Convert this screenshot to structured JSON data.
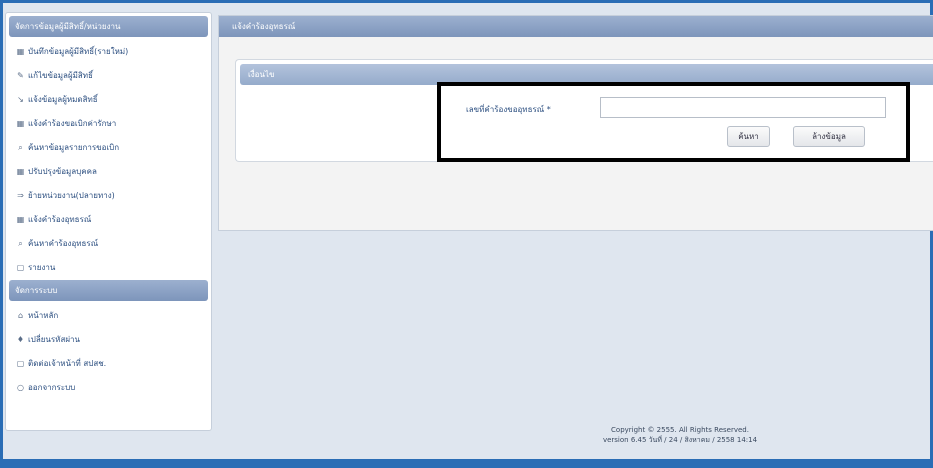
{
  "sidebar": {
    "section1_title": "จัดการข้อมูลผู้มีสิทธิ์/หน่วยงาน",
    "items1": [
      {
        "icon": "▦",
        "icon_name": "grid-icon",
        "label": "บันทึกข้อมูลผู้มีสิทธิ์(รายใหม่)"
      },
      {
        "icon": "✎",
        "icon_name": "pencil-icon",
        "label": "แก้ไขข้อมูลผู้มีสิทธิ์"
      },
      {
        "icon": "↘",
        "icon_name": "arrow-icon",
        "label": "แจ้งข้อมูลผู้หมดสิทธิ์"
      },
      {
        "icon": "▦",
        "icon_name": "grid-icon",
        "label": "แจ้งคำร้องขอเบิกค่ารักษา"
      },
      {
        "icon": "⌕",
        "icon_name": "search-icon",
        "label": "ค้นหาข้อมูลรายการขอเบิก"
      },
      {
        "icon": "▦",
        "icon_name": "grid-icon",
        "label": "ปรับปรุงข้อมูลบุคคล"
      },
      {
        "icon": "⇒",
        "icon_name": "transfer-icon",
        "label": "ย้ายหน่วยงาน(ปลายทาง)"
      },
      {
        "icon": "▦",
        "icon_name": "grid-icon",
        "label": "แจ้งคำร้องอุทธรณ์"
      },
      {
        "icon": "⌕",
        "icon_name": "search-icon",
        "label": "ค้นหาคำร้องอุทธรณ์"
      },
      {
        "icon": "▢",
        "icon_name": "report-icon",
        "label": "รายงาน"
      }
    ],
    "section2_title": "จัดการระบบ",
    "items2": [
      {
        "icon": "⌂",
        "icon_name": "home-icon",
        "label": "หน้าหลัก"
      },
      {
        "icon": "♦",
        "icon_name": "key-icon",
        "label": "เปลี่ยนรหัสผ่าน"
      },
      {
        "icon": "▢",
        "icon_name": "contact-icon",
        "label": "ติดต่อเจ้าหน้าที่ สปสช."
      },
      {
        "icon": "○",
        "icon_name": "logout-icon",
        "label": "ออกจากระบบ"
      }
    ]
  },
  "main": {
    "title": "แจ้งคำร้องอุทธรณ์",
    "panel_title": "เงื่อนไข",
    "field_label": "เลขที่คำร้องขออุทธรณ์ *",
    "field_value": "",
    "search_button": "ค้นหา",
    "clear_button": "ล้างข้อมูล"
  },
  "footer": {
    "line1": "Copyright © 2555. All Rights Reserved.",
    "line2": "version 6.45 วันที่ / 24 / สิงหาคม / 2558 14:14"
  }
}
